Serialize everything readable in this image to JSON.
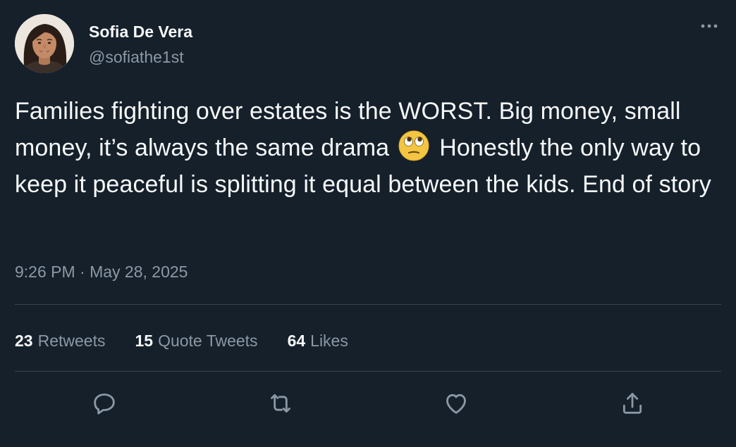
{
  "author": {
    "display_name": "Sofia De Vera",
    "handle": "@sofiathe1st",
    "avatar_icon": "profile-photo"
  },
  "tweet": {
    "text_before_emoji": "Families fighting over estates is the WORST. Big money, small money, it’s always the same drama",
    "emoji": "face-with-rolling-eyes",
    "text_after_emoji": "Honestly the only way to keep it peaceful is splitting it equal between the kids. End of story",
    "timestamp": "9:26 PM · May 28, 2025"
  },
  "stats": {
    "retweets_count": "23",
    "retweets_label": "Retweets",
    "quotes_count": "15",
    "quotes_label": "Quote Tweets",
    "likes_count": "64",
    "likes_label": "Likes"
  },
  "actions": [
    {
      "name": "reply",
      "icon": "comment-icon"
    },
    {
      "name": "retweet",
      "icon": "retweet-icon"
    },
    {
      "name": "like",
      "icon": "heart-icon"
    },
    {
      "name": "share",
      "icon": "share-icon"
    }
  ],
  "colors": {
    "background": "#15202b",
    "text_primary": "#f7f9f9",
    "text_secondary": "#8b98a5",
    "divider": "#38444d"
  }
}
